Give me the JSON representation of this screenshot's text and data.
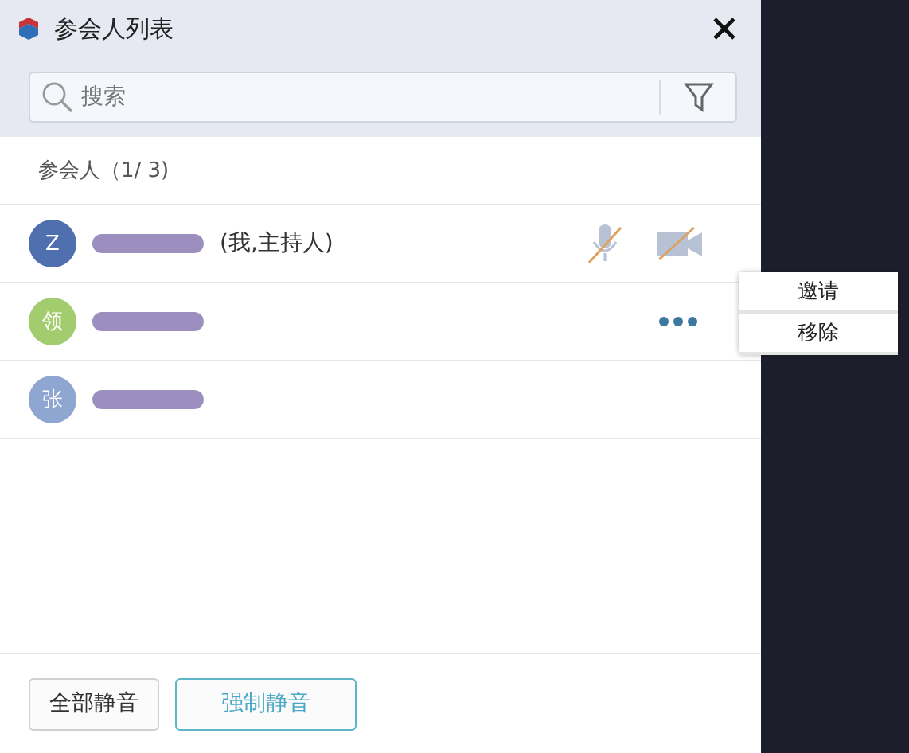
{
  "window": {
    "title": "参会人列表"
  },
  "search": {
    "placeholder": "搜索"
  },
  "section": {
    "label": "参会人（1/ 3)"
  },
  "participants": [
    {
      "kind": "media",
      "avatar": "Z",
      "color": "#4f6fae",
      "suffix": "(我,主持人)",
      "mic_muted": true,
      "camera_off": true
    },
    {
      "kind": "more",
      "avatar": "领",
      "color": "#a3cc6e"
    },
    {
      "kind": "plain",
      "avatar": "张",
      "color": "#8fa6d0"
    }
  ],
  "context_menu": [
    "邀请",
    "移除"
  ],
  "buttons": [
    {
      "label": "全部静音",
      "primary": false
    },
    {
      "label": "强制静音",
      "primary": true
    }
  ]
}
